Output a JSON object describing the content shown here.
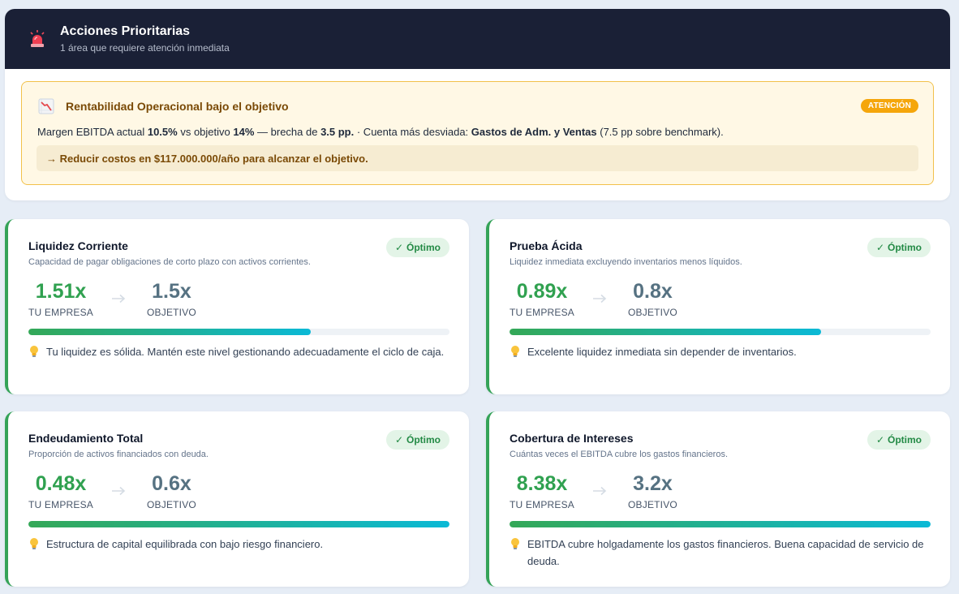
{
  "priority": {
    "title": "Acciones Prioritarias",
    "subtitle": "1 área que requiere atención inmediata",
    "alert": {
      "title": "Rentabilidad Operacional bajo el objetivo",
      "badge": "ATENCIÓN",
      "body_prefix": "Margen EBITDA actual ",
      "current_margin": "10.5%",
      "body_mid1": " vs objetivo ",
      "target_margin": "14%",
      "body_mid2": " — brecha de ",
      "gap": "3.5 pp.",
      "body_mid3": " · Cuenta más desviada: ",
      "deviated_account": "Gastos de Adm. y Ventas",
      "body_suffix": " (7.5 pp sobre benchmark).",
      "action": "→ Reducir costos en $117.000.000/año para alcanzar el objetivo."
    }
  },
  "metrics": [
    {
      "title": "Liquidez Corriente",
      "description": "Capacidad de pagar obligaciones de corto plazo con activos corrientes.",
      "status": "Óptimo",
      "company_value": "1.51x",
      "company_label": "TU EMPRESA",
      "target_value": "1.5x",
      "target_label": "OBJETIVO",
      "progress": 0.67,
      "tip": "Tu liquidez es sólida. Mantén este nivel gestionando adecuadamente el ciclo de caja."
    },
    {
      "title": "Prueba Ácida",
      "description": "Liquidez inmediata excluyendo inventarios menos líquidos.",
      "status": "Óptimo",
      "company_value": "0.89x",
      "company_label": "TU EMPRESA",
      "target_value": "0.8x",
      "target_label": "OBJETIVO",
      "progress": 0.74,
      "tip": "Excelente liquidez inmediata sin depender de inventarios."
    },
    {
      "title": "Endeudamiento Total",
      "description": "Proporción de activos financiados con deuda.",
      "status": "Óptimo",
      "company_value": "0.48x",
      "company_label": "TU EMPRESA",
      "target_value": "0.6x",
      "target_label": "OBJETIVO",
      "progress": 1.0,
      "tip": "Estructura de capital equilibrada con bajo riesgo financiero."
    },
    {
      "title": "Cobertura de Intereses",
      "description": "Cuántas veces el EBITDA cubre los gastos financieros.",
      "status": "Óptimo",
      "company_value": "8.38x",
      "company_label": "TU EMPRESA",
      "target_value": "3.2x",
      "target_label": "OBJETIVO",
      "progress": 1.0,
      "tip": "EBITDA cubre holgadamente los gastos financieros. Buena capacidad de servicio de deuda."
    }
  ],
  "icons": {
    "header": "siren-icon",
    "alert": "chart-decreasing-icon",
    "status": "check-icon",
    "comparison": "arrow-right-icon",
    "tip": "lightbulb-icon"
  },
  "colors": {
    "header_bg": "#1a2036",
    "alert_bg": "#fff8e5",
    "alert_border": "#f2c14b",
    "badge": "#f5a60b",
    "good": "#30a150",
    "target": "#567282",
    "progress_start": "#34a857",
    "progress_end": "#0bb9d6"
  }
}
